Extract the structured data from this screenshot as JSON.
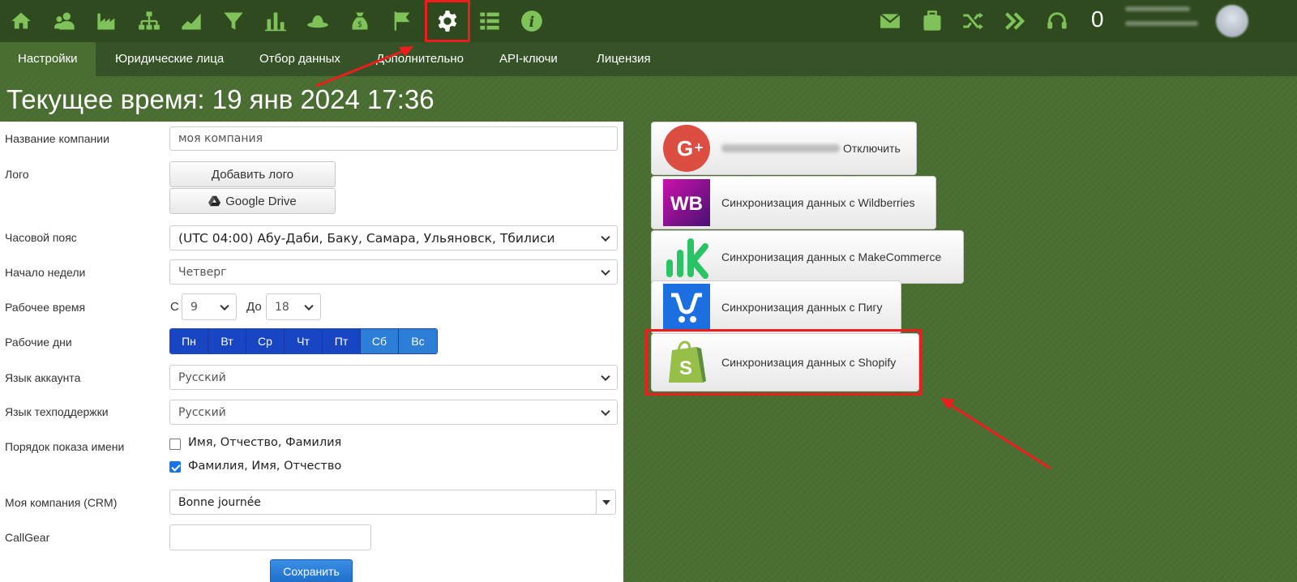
{
  "topbar": {
    "icons": [
      "home-icon",
      "contacts-icon",
      "factory-icon",
      "org-chart-icon",
      "area-chart-icon",
      "filter-icon",
      "bar-chart-icon",
      "hat-icon",
      "money-bag-icon",
      "flag-icon",
      "gear-icon",
      "list-icon",
      "info-icon"
    ],
    "right_icons": [
      "mail-icon",
      "briefcase-icon",
      "shuffle-icon",
      "chevrons-right-icon",
      "headset-icon"
    ],
    "counter": "0",
    "accent": "#2f4a1f"
  },
  "tabs": [
    {
      "label": "Настройки",
      "active": true
    },
    {
      "label": "Юридические лица"
    },
    {
      "label": "Отбор данных"
    },
    {
      "label": "Дополнительно"
    },
    {
      "label": "API-ключи"
    },
    {
      "label": "Лицензия"
    }
  ],
  "page_title": "Текущее время: 19 янв 2024 17:36",
  "form": {
    "company_name": {
      "label": "Название компании",
      "value": "моя компания"
    },
    "logo": {
      "label": "Лого",
      "add_button": "Добавить лого",
      "drive_button": "Google Drive"
    },
    "timezone": {
      "label": "Часовой пояс",
      "value": "(UTC 04:00) Абу-Даби, Баку, Самара, Ульяновск, Тбилиси"
    },
    "week_start": {
      "label": "Начало недели",
      "value": "Четверг"
    },
    "work_time": {
      "label": "Рабочее время",
      "from_label": "С",
      "from_value": "9",
      "to_label": "До",
      "to_value": "18"
    },
    "work_days": {
      "label": "Рабочие дни",
      "days": [
        "Пн",
        "Вт",
        "Ср",
        "Чт",
        "Пт",
        "Сб",
        "Вс"
      ]
    },
    "account_lang": {
      "label": "Язык аккаунта",
      "value": "Русский"
    },
    "support_lang": {
      "label": "Язык техподдержки",
      "value": "Русский"
    },
    "name_order": {
      "label": "Порядок показа имени",
      "options": [
        {
          "label": "Имя, Отчество, Фамилия",
          "checked": false
        },
        {
          "label": "Фамилия, Имя, Отчество",
          "checked": true
        }
      ]
    },
    "crm_company": {
      "label": "Моя компания (CRM)",
      "value": "Bonne journée"
    },
    "callgear": {
      "label": "CallGear",
      "value": ""
    },
    "save_button": "Сохранить"
  },
  "integrations": [
    {
      "name": "google",
      "label": "Отключить"
    },
    {
      "name": "wildberries",
      "label": "Синхронизация данных с Wildberries",
      "logo_text": "WB"
    },
    {
      "name": "makecommerce",
      "label": "Синхронизация данных с MakeCommerce"
    },
    {
      "name": "pigu",
      "label": "Синхронизация данных с Пигу"
    },
    {
      "name": "shopify",
      "label": "Синхронизация данных с Shopify"
    }
  ],
  "colors": {
    "highlight": "#ee1c1c",
    "workday": "#1846c2",
    "weekend": "#2c7ed6"
  }
}
